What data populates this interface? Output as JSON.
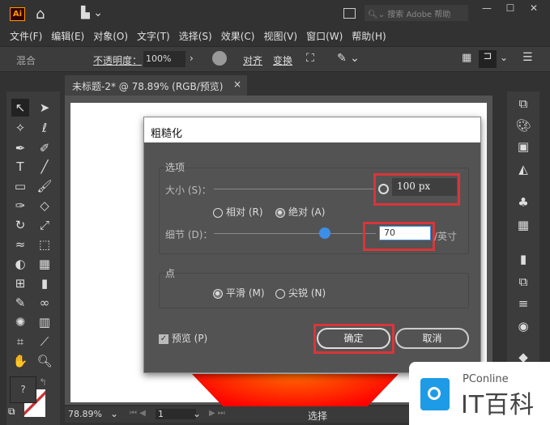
{
  "app": {
    "logo": "Ai",
    "search_placeholder": "搜索 Adobe 帮助"
  },
  "menu": [
    "文件(F)",
    "编辑(E)",
    "对象(O)",
    "文字(T)",
    "选择(S)",
    "效果(C)",
    "视图(V)",
    "窗口(W)",
    "帮助(H)"
  ],
  "control": {
    "blend": "混合",
    "opacity_label": "不透明度：",
    "opacity_value": "100%",
    "align": "对齐",
    "transform": "变换"
  },
  "tab": {
    "title": "未标题-2* @ 78.89% (RGB/预览)",
    "close": "×"
  },
  "dialog": {
    "title": "粗糙化",
    "options_group": "选项",
    "size_label": "大小 (S)：",
    "size_value": "100 px",
    "size_mode": [
      {
        "label": "相对 (R)",
        "selected": false
      },
      {
        "label": "绝对 (A)",
        "selected": true
      }
    ],
    "detail_label": "细节 (D)：",
    "detail_value": "70",
    "detail_unit": "/英寸",
    "detail_slider_fraction": 0.7,
    "points_group": "点",
    "points": [
      {
        "label": "平滑 (M)",
        "selected": true
      },
      {
        "label": "尖锐 (N)",
        "selected": false
      }
    ],
    "preview_label": "预览 (P)",
    "preview_checked": true,
    "ok": "确定",
    "cancel": "取消"
  },
  "status": {
    "zoom": "78.89%",
    "artboard": "1",
    "tool": "选择"
  },
  "watermark": {
    "brand": "PConline",
    "name": "IT百科"
  },
  "colors": {
    "highlight": "#d9353a",
    "accent": "#3d8ee8"
  }
}
